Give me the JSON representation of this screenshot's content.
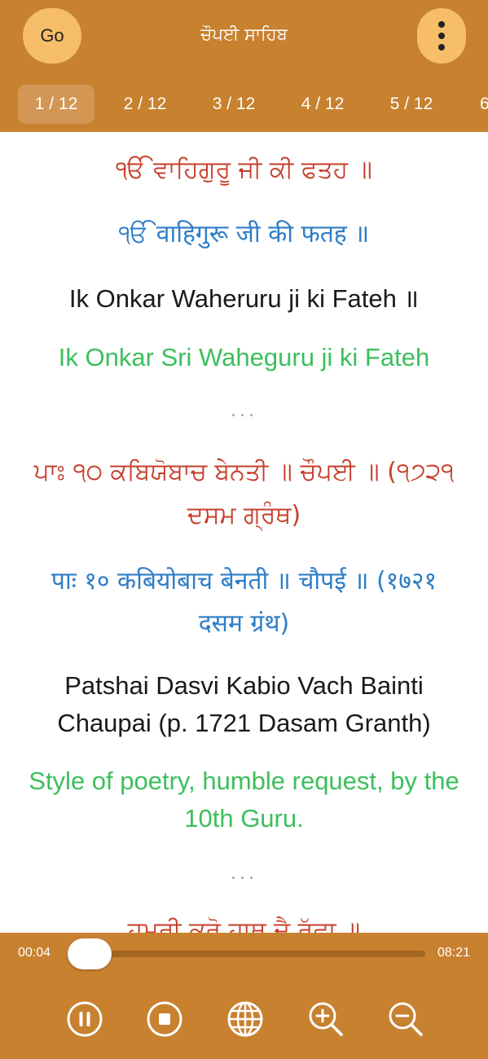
{
  "header": {
    "go_label": "Go",
    "title": "ਚੌਪਈ ਸਾਹਿਬ"
  },
  "tabs": [
    {
      "label": "1 / 12",
      "active": true
    },
    {
      "label": "2 / 12",
      "active": false
    },
    {
      "label": "3 / 12",
      "active": false
    },
    {
      "label": "4 / 12",
      "active": false
    },
    {
      "label": "5 / 12",
      "active": false
    },
    {
      "label": "6",
      "active": false
    }
  ],
  "verses": [
    {
      "gurmukhi": "ੴ ਵਾਹਿਗੁਰੂ ਜੀ ਕੀ ਫਤਹ ॥",
      "hindi": "ੴ वाहिगुरू जी की फतह ॥",
      "transliteration": "Ik Onkar Waheruru ji ki Fateh ॥",
      "english": "Ik Onkar Sri Waheguru ji ki Fateh"
    },
    {
      "gurmukhi_lines": [
        "ਪਾਃ ੧੦ ਕਬਿਯੋਬਾਚ ਬੇਨਤੀ ॥ ਚੌਪਈ ॥ (੧੭੨੧",
        "ਦਸਮ ਗ੍ਰੰਥ)"
      ],
      "hindi_lines": [
        "पाः १० कबियोबाच बेनती ॥ चौपई ॥ (१७२१",
        "दसम ग्रंथ)"
      ],
      "transliteration_lines": [
        "Patshai Dasvi Kabio Vach Bainti",
        "Chaupai (p. 1721 Dasam Granth)"
      ],
      "english_lines": [
        "Style of poetry, humble request, by the",
        "10th Guru."
      ]
    },
    {
      "gurmukhi": "ਹਮਰੀ ਕਰੋ ਹਾਥ ਦੈ ਰੱਛਾ ॥"
    }
  ],
  "separator": "...",
  "player": {
    "current_time": "00:04",
    "total_time": "08:21",
    "progress": 0.008
  },
  "colors": {
    "primary": "#c8812f",
    "button": "#f7be6a",
    "gurmukhi": "#c63d2a",
    "hindi": "#2e7dc7",
    "english": "#3cbf5c"
  },
  "controls": [
    "pause-icon",
    "stop-icon",
    "globe-icon",
    "zoom-in-icon",
    "zoom-out-icon"
  ]
}
